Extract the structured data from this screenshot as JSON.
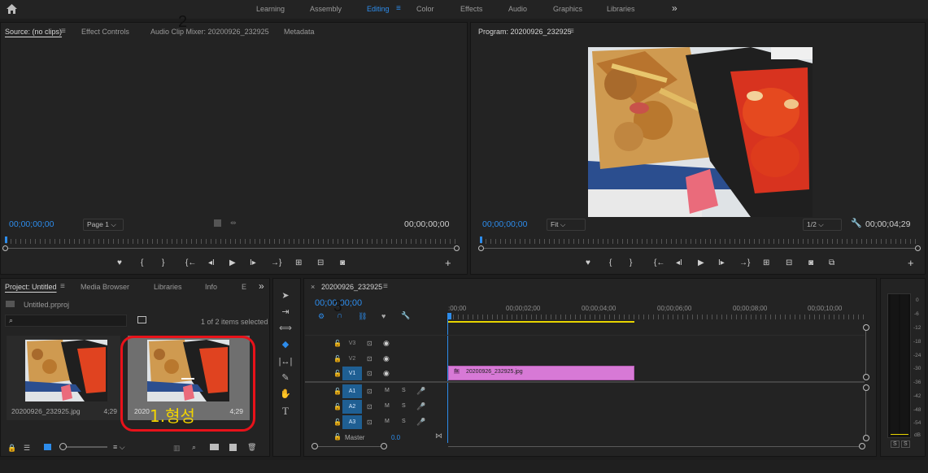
{
  "workspace": {
    "tabs": [
      "Learning",
      "Assembly",
      "Editing",
      "Color",
      "Effects",
      "Audio",
      "Graphics",
      "Libraries"
    ],
    "active": "Editing",
    "more": "»"
  },
  "source": {
    "tabs": [
      "Source: (no clips)",
      "Effect Controls",
      "Audio Clip Mixer: 20200926_232925",
      "Metadata"
    ],
    "tc_left": "00;00;00;00",
    "page": "Page 1",
    "tc_right": "00;00;00;00"
  },
  "program": {
    "title": "Program: 20200926_232925",
    "tc_left": "00;00;00;00",
    "fit": "Fit",
    "res": "1/2",
    "duration": "00;00;04;29"
  },
  "project": {
    "tabs": [
      "Project: Untitled",
      "Media Browser",
      "Libraries",
      "Info",
      "E"
    ],
    "file": "Untitled.prproj",
    "selection": "1 of 2 items selected",
    "items": [
      {
        "name": "20200926_232925.jpg",
        "dur": "4;29"
      },
      {
        "name": "2020",
        "dur": "4;29"
      }
    ]
  },
  "annotations": {
    "a1": "1.형성",
    "a2": "2",
    "a3": "3"
  },
  "timeline": {
    "seq": "20200926_232925",
    "tc": "00;00;00;00",
    "ruler": [
      ":00;00",
      "00;00;02;00",
      "00;00;04;00",
      "00;00;06;00",
      "00;00;08;00",
      "00;00;10;00"
    ],
    "video": [
      "V3",
      "V2",
      "V1"
    ],
    "audio": [
      "A1",
      "A2",
      "A3"
    ],
    "master": "Master",
    "master_val": "0.0",
    "clip": "20200926_232925.jpg",
    "fx": "fx",
    "m": "M",
    "s": "S"
  },
  "meter": {
    "labels": [
      "0",
      "-6",
      "-12",
      "-18",
      "-24",
      "-30",
      "-36",
      "-42",
      "-48",
      "-54",
      "dB"
    ],
    "s1": "S",
    "s2": "S"
  },
  "colors": {
    "accent": "#2d8ceb",
    "clip": "#d779d6",
    "annotation": "#e8121a",
    "annotation_text": "#f2d400"
  }
}
